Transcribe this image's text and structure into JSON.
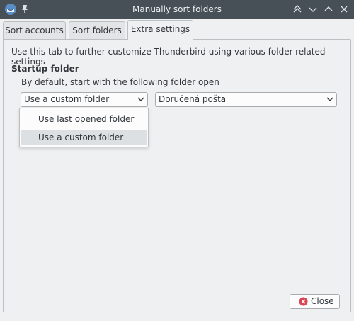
{
  "window": {
    "title": "Manually sort folders",
    "icons": [
      "thunderbird-app-icon",
      "pin-icon",
      "chevron-up-double-icon",
      "chevron-down-icon",
      "chevron-up-icon",
      "close-window-icon"
    ]
  },
  "tabs": [
    {
      "label": "Sort accounts",
      "active": false
    },
    {
      "label": "Sort folders",
      "active": false
    },
    {
      "label": "Extra settings",
      "active": true
    }
  ],
  "extra_settings": {
    "intro": "Use this tab to further customize Thunderbird using various folder-related settings",
    "startup": {
      "title": "Startup folder",
      "description": "By default, start with the following folder open",
      "mode_select": {
        "value": "Use a custom folder",
        "options": [
          "Use last opened folder",
          "Use a custom folder"
        ],
        "highlighted": "Use a custom folder"
      },
      "folder_select": {
        "value": "Doručená pošta"
      }
    }
  },
  "footer": {
    "close_label": "Close"
  },
  "colors": {
    "titlebar": "#475057",
    "window_bg": "#eff0f1",
    "close_icon": "#da4453"
  }
}
